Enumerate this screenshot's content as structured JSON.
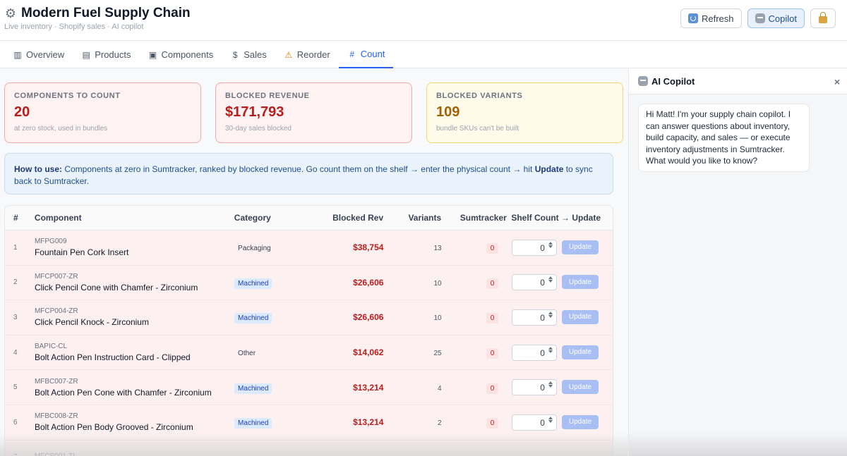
{
  "header": {
    "title": "Modern Fuel Supply Chain",
    "icon": "gear-icon",
    "subtitle": "Live inventory · Shopify sales · AI copilot",
    "buttons": {
      "refresh": "Refresh",
      "copilot": "Copilot"
    }
  },
  "tabs": [
    {
      "label": "Overview",
      "icon": "chart-icon"
    },
    {
      "label": "Products",
      "icon": "clipboard-icon"
    },
    {
      "label": "Components",
      "icon": "package-icon"
    },
    {
      "label": "Sales",
      "icon": "money-bag-icon"
    },
    {
      "label": "Reorder",
      "icon": "warning-icon"
    },
    {
      "label": "Count",
      "icon": "numbers-icon",
      "active": true
    }
  ],
  "cards": [
    {
      "label": "COMPONENTS TO COUNT",
      "value": "20",
      "desc": "at zero stock, used in bundles"
    },
    {
      "label": "BLOCKED REVENUE",
      "value": "$171,793",
      "desc": "30-day sales blocked"
    },
    {
      "label": "BLOCKED VARIANTS",
      "value": "109",
      "desc": "bundle SKUs can't be built"
    }
  ],
  "info": {
    "lead": "How to use:",
    "text1": " Components at zero in Sumtracker, ranked by blocked revenue. Go count them on the shelf → enter the physical count → hit ",
    "strong": "Update",
    "text2": " to sync back to Sumtracker."
  },
  "table": {
    "headers": {
      "idx": "#",
      "component": "Component",
      "category": "Category",
      "blocked_rev": "Blocked Rev",
      "variants": "Variants",
      "sumtracker": "Sumtracker",
      "shelf": "Shelf Count → Update"
    },
    "update_label": "Update",
    "rows": [
      {
        "idx": "1",
        "sku": "MFPG009",
        "name": "Fountain Pen Cork Insert",
        "category": "Packaging",
        "rev": "$38,754",
        "variants": "13",
        "sum": "0",
        "count": "0"
      },
      {
        "idx": "2",
        "sku": "MFCP007-ZR",
        "name": "Click Pencil Cone with Chamfer - Zirconium",
        "category": "Machined",
        "rev": "$26,606",
        "variants": "10",
        "sum": "0",
        "count": "0"
      },
      {
        "idx": "3",
        "sku": "MFCP004-ZR",
        "name": "Click Pencil Knock - Zirconium",
        "category": "Machined",
        "rev": "$26,606",
        "variants": "10",
        "sum": "0",
        "count": "0"
      },
      {
        "idx": "4",
        "sku": "BAPIC-CL",
        "name": "Bolt Action Pen Instruction Card - Clipped",
        "category": "Other",
        "rev": "$14,062",
        "variants": "25",
        "sum": "0",
        "count": "0"
      },
      {
        "idx": "5",
        "sku": "MFBC007-ZR",
        "name": "Bolt Action Pen Cone with Chamfer - Zirconium",
        "category": "Machined",
        "rev": "$13,214",
        "variants": "4",
        "sum": "0",
        "count": "0"
      },
      {
        "idx": "6",
        "sku": "MFBC008-ZR",
        "name": "Bolt Action Pen Body Grooved - Zirconium",
        "category": "Machined",
        "rev": "$13,214",
        "variants": "2",
        "sum": "0",
        "count": "0"
      },
      {
        "idx": "7",
        "sku": "MFCP001-TI",
        "name": "",
        "category": "",
        "rev": "",
        "variants": "",
        "sum": "",
        "count": ""
      }
    ]
  },
  "copilot": {
    "title": "AI Copilot",
    "close": "×",
    "message": "Hi Matt! I'm your supply chain copilot. I can answer questions about inventory, build capacity, and sales — or execute inventory adjustments in Sumtracker. What would you like to know?"
  },
  "colors": {
    "accent": "#2563eb",
    "danger": "#b91c1c",
    "warning": "#a16207"
  }
}
